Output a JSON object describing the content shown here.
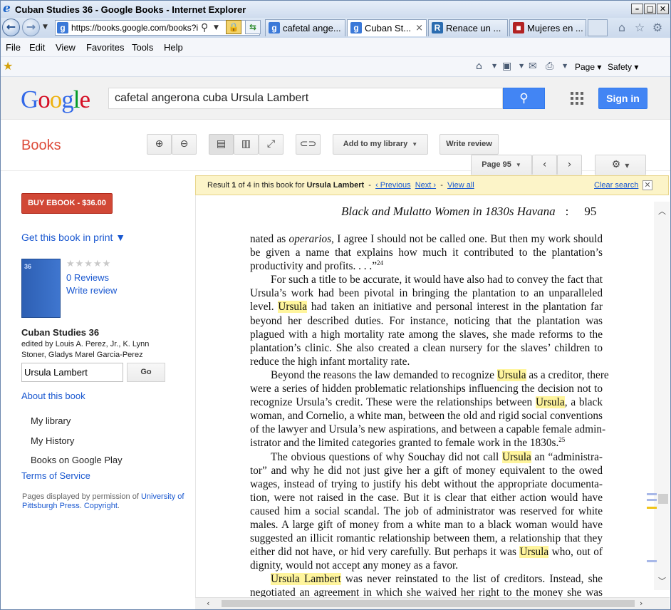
{
  "browser": {
    "window_title": "Cuban Studies 36 - Google Books - Internet Explorer",
    "address": "https://books.google.com/books?id=",
    "tabs": [
      {
        "label": "cafetal ange...",
        "icon": "google-g-icon"
      },
      {
        "label": "Cuban St...",
        "icon": "google-g-icon",
        "close": "×"
      },
      {
        "label": "Renace un ...",
        "icon": "site-r-icon"
      },
      {
        "label": "Mujeres en ...",
        "icon": "site-m-icon"
      }
    ],
    "menu": [
      "File",
      "Edit",
      "View",
      "Favorites",
      "Tools",
      "Help"
    ],
    "command": {
      "page": "Page",
      "safety": "Safety"
    }
  },
  "google": {
    "logo": [
      "G",
      "o",
      "o",
      "g",
      "l",
      "e"
    ],
    "query": "cafetal angerona cuba Ursula Lambert",
    "signin": "Sign in"
  },
  "toolbar": {
    "books_label": "Books",
    "add_library": "Add to my library",
    "write_review": "Write review",
    "page_select": "Page 95"
  },
  "sidebar": {
    "buy": "BUY EBOOK - $36.00",
    "get_print": "Get this book in print ▼",
    "cover_text": "36",
    "stars": "★★★★★",
    "reviews": "0 Reviews",
    "write_review": "Write review",
    "title": "Cuban Studies 36",
    "authors_line1": "edited by Louis A. Perez, Jr., K. Lynn",
    "authors_line2": "Stoner, Gladys Marel Garcia-Perez",
    "search_value": "Ursula Lambert",
    "go": "Go",
    "about": "About this book",
    "nav": [
      "My library",
      "My History",
      "Books on Google Play"
    ],
    "terms": "Terms of Service",
    "perm_prefix": "Pages displayed by permission of ",
    "perm_link": "University of Pittsburgh Press",
    "perm_sep": ". ",
    "perm_copyright": "Copyright",
    "perm_end": "."
  },
  "result_bar": {
    "result_word": "Result",
    "num": "1",
    "of_text": "of 4 in this book for",
    "query": "Ursula Lambert",
    "prev": "‹ Previous",
    "next": "Next ›",
    "view_all": "View all",
    "clear": "Clear search",
    "dash": "-"
  },
  "page": {
    "running_head": "Black and Mulatto Women in 1830s Havana",
    "colon": ":",
    "page_number": "95",
    "lines": [
      [
        "nated as ",
        {
          "i": "operarios"
        },
        ", I agree I should not be called one. But then my work should"
      ],
      [
        "be given a name that explains how much it contributed to the plantation’s"
      ],
      [
        "productivity and profits. . . .”",
        {
          "sup": "24"
        }
      ],
      [
        "For such a title to be accurate, it would have also had to convey the fact that"
      ],
      [
        "Ursula’s work had been pivotal in bringing the plantation to an unparalleled"
      ],
      [
        "level. ",
        {
          "h": "Ursula"
        },
        " had taken an initiative and personal interest in the plantation far"
      ],
      [
        "beyond her described duties. For instance, noticing that the plantation was"
      ],
      [
        "plagued with a high mortality rate among the slaves, she made reforms to the"
      ],
      [
        "plantation’s clinic. She also created a clean nursery for the slaves’ children to"
      ],
      [
        "reduce the high infant mortality rate."
      ],
      [
        "Beyond the reasons the law demanded to recognize ",
        {
          "h": "Ursula"
        },
        " as a creditor, there"
      ],
      [
        "were a series of hidden problematic relationships influencing the decision not to"
      ],
      [
        "recognize Ursula’s credit. These were the relationships between ",
        {
          "h": "Ursula"
        },
        ", a black"
      ],
      [
        "woman, and Cornelio, a white man, between the old and rigid social conventions"
      ],
      [
        "of the lawyer and Ursula’s new aspirations, and between a capable female admin-"
      ],
      [
        "istrator and the limited categories granted to female work in the 1830s.",
        {
          "sup": "25"
        }
      ],
      [
        "The obvious questions of why Souchay did not call ",
        {
          "h": "Ursula"
        },
        " an “administra-"
      ],
      [
        "tor” and why he did not just give her a gift of money equivalent to the owed"
      ],
      [
        "wages, instead of trying to justify his debt without the appropriate documenta-"
      ],
      [
        "tion, were not raised in the case. But it is clear that either action would have"
      ],
      [
        "caused him a social scandal. The job of administrator was reserved for white"
      ],
      [
        "males. A large gift of money from a white man to a black woman would have"
      ],
      [
        "suggested an illicit romantic relationship between them, a relationship that they"
      ],
      [
        "either did not have, or hid very carefully. But perhaps it was ",
        {
          "h": "Ursula"
        },
        " who, out of"
      ],
      [
        "dignity, would not accept any money as a favor."
      ],
      [
        {
          "h": "Ursula Lambert"
        },
        " was never reinstated to the list of creditors. Instead, she"
      ],
      [
        "negotiated an agreement in which she waived her right to the money she was"
      ]
    ],
    "indent_lines": [
      3,
      10,
      16,
      25
    ],
    "last_lines": [
      2,
      9,
      15,
      24
    ]
  },
  "colors": {
    "highlight": "#fff59d",
    "link": "#1a58d0",
    "buy": "#d14836",
    "books": "#dd4b39",
    "accent": "#4285f4"
  }
}
